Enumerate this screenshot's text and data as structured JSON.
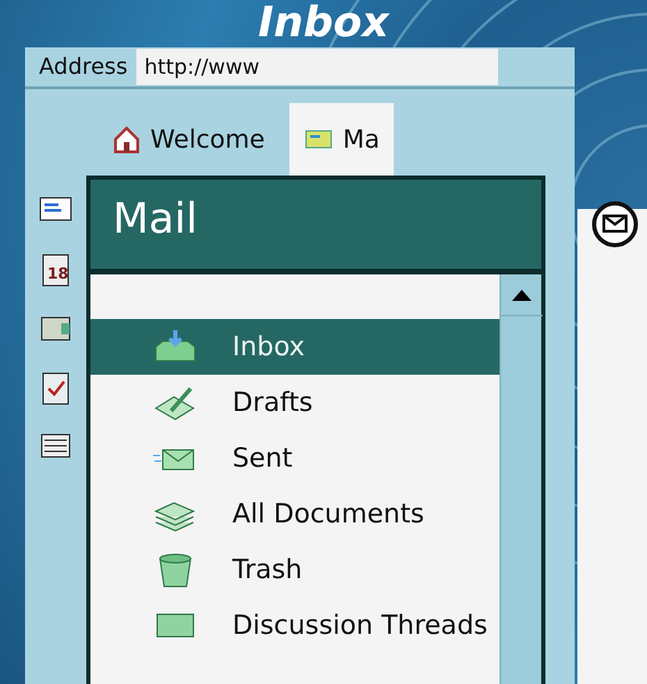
{
  "banner": {
    "title": "Inbox"
  },
  "address_bar": {
    "label": "Address",
    "value": "http://www"
  },
  "tabs": [
    {
      "label": "Welcome",
      "selected": false,
      "kind": "home"
    },
    {
      "label": "Ma",
      "selected": true,
      "kind": "mail"
    }
  ],
  "side_icons": [
    {
      "kind": "letter"
    },
    {
      "kind": "calendar",
      "day": "18"
    },
    {
      "kind": "folder"
    },
    {
      "kind": "checklist"
    },
    {
      "kind": "papers"
    }
  ],
  "panel": {
    "title": "Mail"
  },
  "folders": [
    {
      "label": "Inbox",
      "selected": true,
      "kind": "inbox"
    },
    {
      "label": "Drafts",
      "selected": false,
      "kind": "drafts"
    },
    {
      "label": "Sent",
      "selected": false,
      "kind": "sent"
    },
    {
      "label": "All Documents",
      "selected": false,
      "kind": "docs"
    },
    {
      "label": "Trash",
      "selected": false,
      "kind": "trash"
    },
    {
      "label": "Discussion Threads",
      "selected": false,
      "kind": "threads"
    }
  ]
}
